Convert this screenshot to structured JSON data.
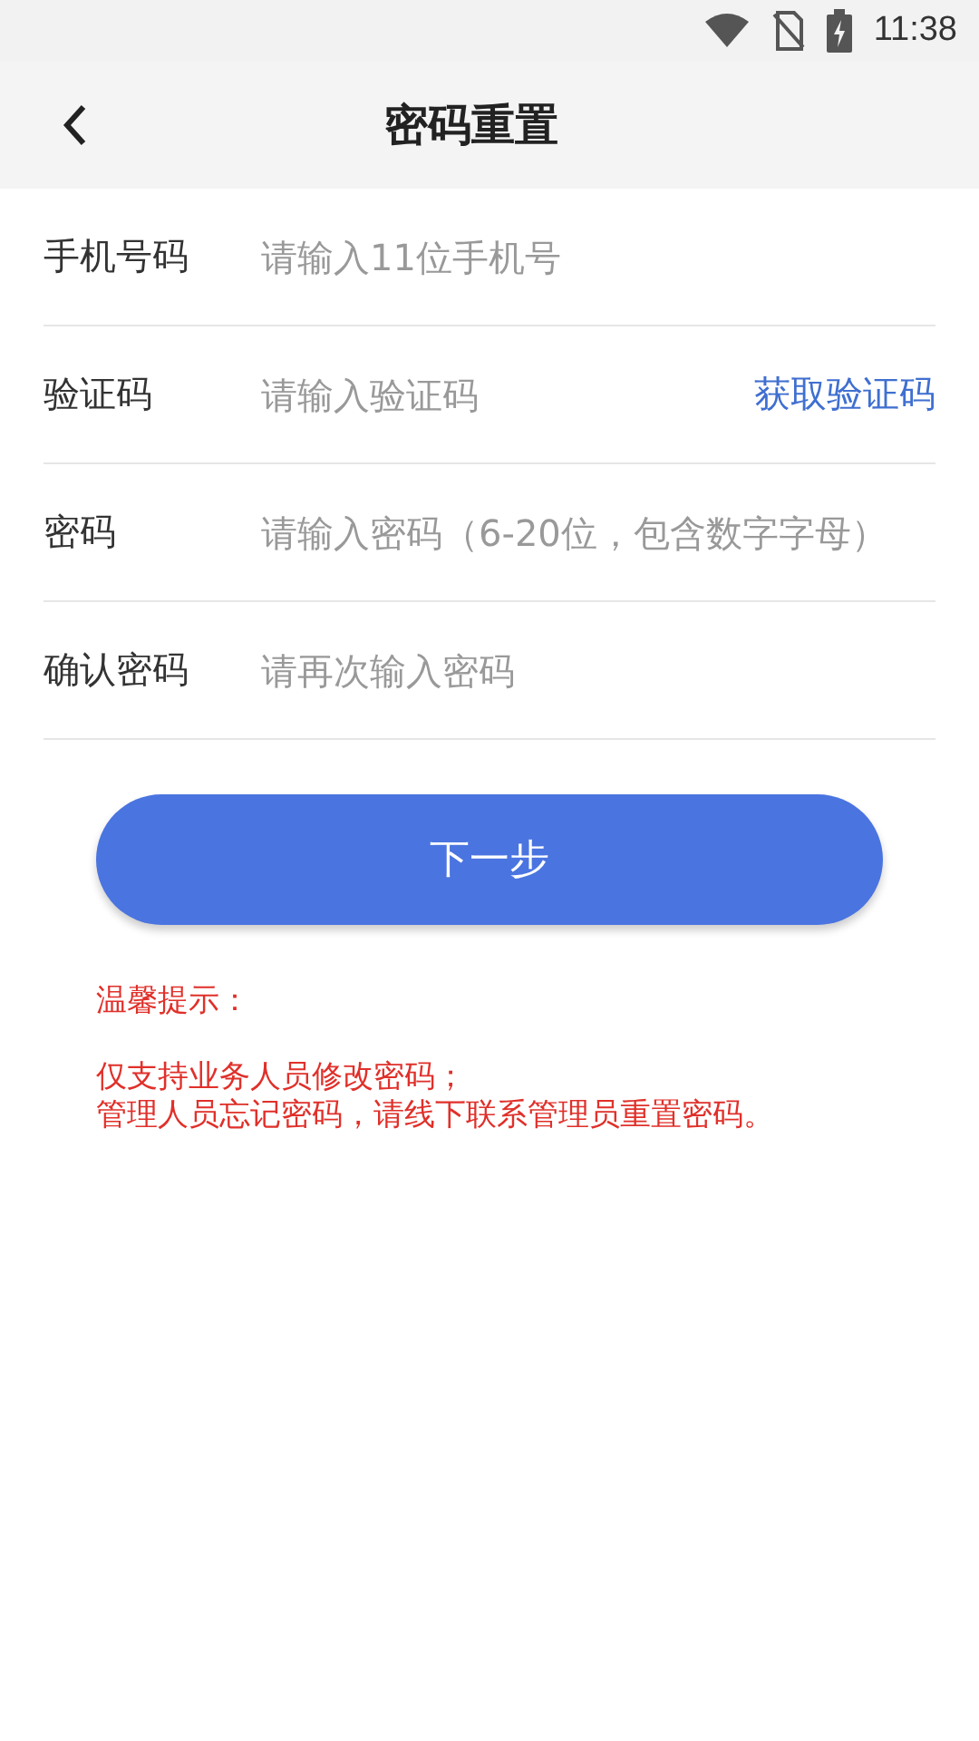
{
  "status_bar": {
    "time": "11:38"
  },
  "header": {
    "title": "密码重置"
  },
  "form": [
    {
      "kind": "input",
      "label": "手机号码",
      "placeholder": "请输入11位手机号"
    },
    {
      "kind": "code",
      "label": "验证码",
      "placeholder": "请输入验证码",
      "action": "获取验证码"
    },
    {
      "kind": "input",
      "label": "密码",
      "placeholder": "请输入密码（6-20位，包含数字字母）"
    },
    {
      "kind": "input",
      "label": "确认密码",
      "placeholder": "请再次输入密码"
    }
  ],
  "next_button": "下一步",
  "notice": {
    "title": "温馨提示：",
    "lines": [
      "仅支持业务人员修改密码；",
      "管理人员忘记密码，请线下联系管理员重置密码。"
    ]
  }
}
